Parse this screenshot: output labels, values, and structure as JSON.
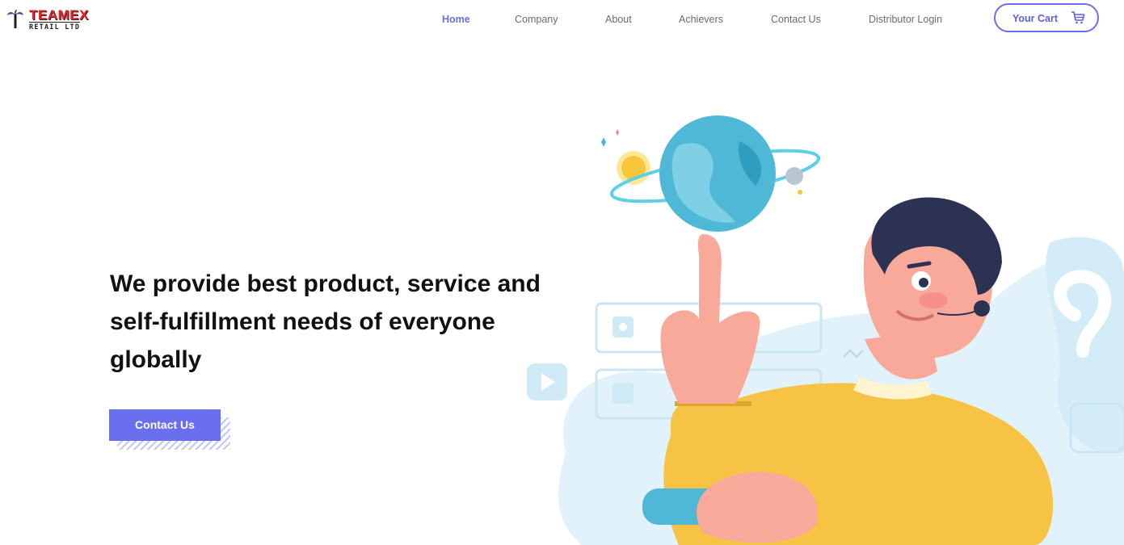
{
  "brand": {
    "name": "TEAMEX",
    "tagline": "RETAIL LTD",
    "accent": "#e8242c"
  },
  "nav": {
    "items": [
      {
        "label": "Home",
        "active": true
      },
      {
        "label": "Company",
        "active": false
      },
      {
        "label": "About",
        "active": false
      },
      {
        "label": "Achievers",
        "active": false
      },
      {
        "label": "Contact Us",
        "active": false
      },
      {
        "label": "Distributor Login",
        "active": false
      }
    ],
    "cart_label": "Your Cart",
    "cart_icon": "shopping-cart-icon"
  },
  "hero": {
    "title": "We provide best product, service and self-fulfillment needs of everyone globally",
    "cta_label": "Contact Us"
  },
  "colors": {
    "primary": "#6a6ff0",
    "text": "#111111",
    "nav_text": "#6b6b6b",
    "figure_shirt": "#f6c344",
    "globe": "#4fb8d6"
  }
}
